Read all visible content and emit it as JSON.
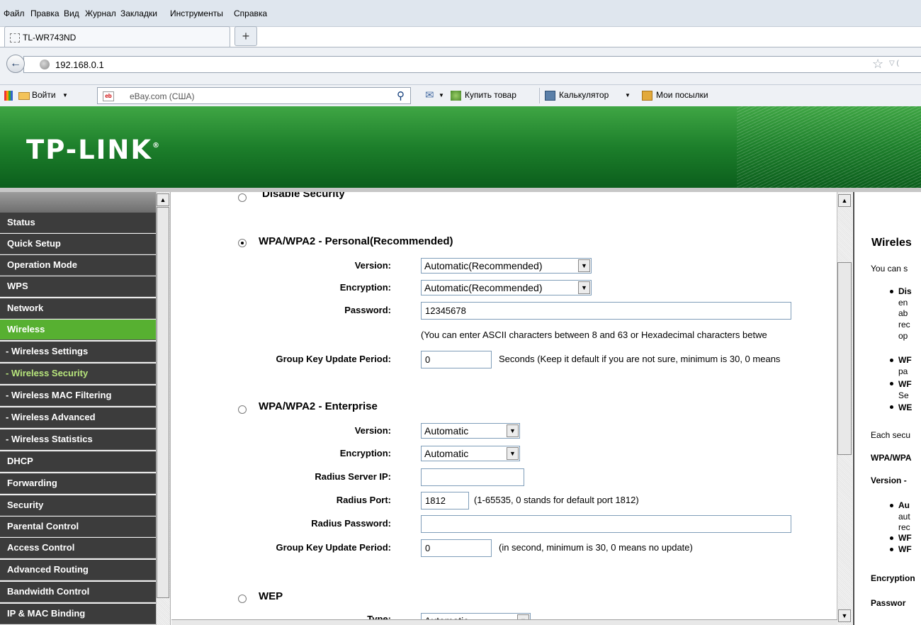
{
  "menu": [
    "Файл",
    "Правка",
    "Вид",
    "Журнал",
    "Закладки",
    "Инструменты",
    "Справка"
  ],
  "tab": {
    "title": "TL-WR743ND",
    "new_tab": "+"
  },
  "nav": {
    "url": "192.168.0.1",
    "back": "←",
    "star": "☆",
    "dropdown": "▽ ("
  },
  "toolbar": {
    "login": "Войти",
    "search_placeholder": "eBay.com (США)",
    "buy": "Купить товар",
    "calc": "Калькулятор",
    "parcels": "Мои посылки"
  },
  "brand": {
    "logo": "TP-LINK",
    "mark": "®"
  },
  "sidebar": {
    "items": [
      "Status",
      "Quick Setup",
      "Operation Mode",
      "WPS",
      "Network",
      "Wireless",
      "- Wireless Settings",
      "- Wireless Security",
      "- Wireless MAC Filtering",
      "- Wireless Advanced",
      "- Wireless Statistics",
      "DHCP",
      "Forwarding",
      "Security",
      "Parental Control",
      "Access Control",
      "Advanced Routing",
      "Bandwidth Control",
      "IP & MAC Binding"
    ]
  },
  "main": {
    "disable_security": "Disable Security",
    "personal": {
      "title": "WPA/WPA2 - Personal(Recommended)",
      "version_label": "Version:",
      "version_value": "Automatic(Recommended)",
      "encryption_label": "Encryption:",
      "encryption_value": "Automatic(Recommended)",
      "password_label": "Password:",
      "password_value": "12345678",
      "password_hint": "(You can enter ASCII characters between 8 and 63 or Hexadecimal characters betwe",
      "gkup_label": "Group Key Update Period:",
      "gkup_value": "0",
      "gkup_hint": "Seconds (Keep it default if you are not sure, minimum is 30, 0 means"
    },
    "enterprise": {
      "title": "WPA/WPA2 - Enterprise",
      "version_label": "Version:",
      "version_value": "Automatic",
      "encryption_label": "Encryption:",
      "encryption_value": "Automatic",
      "radius_ip_label": "Radius Server IP:",
      "radius_ip_value": "",
      "radius_port_label": "Radius Port:",
      "radius_port_value": "1812",
      "radius_port_hint": "(1-65535, 0 stands for default port 1812)",
      "radius_pw_label": "Radius Password:",
      "radius_pw_value": "",
      "gkup_label": "Group Key Update Period:",
      "gkup_value": "0",
      "gkup_hint": "(in second, minimum is 30, 0 means no update)"
    },
    "wep": {
      "title": "WEP",
      "type_label": "Type:",
      "type_value": "Automatic"
    }
  },
  "help": {
    "title": "Wireles",
    "intro": "You can s",
    "b1": "Dis",
    "b1a": "en",
    "b1b": "ab",
    "b1c": "rec",
    "b1d": "op",
    "b2": "WF",
    "b2a": "pa",
    "b3": "WF",
    "b3a": "Se",
    "b4": "WE",
    "each": "Each secu",
    "wpa": "WPA/WPA",
    "version": "Version -",
    "v1": "Au",
    "v1a": "aut",
    "v1b": "rec",
    "v2": "WF",
    "v3": "WF",
    "encryption": "Encryption",
    "password": "Passwor"
  }
}
